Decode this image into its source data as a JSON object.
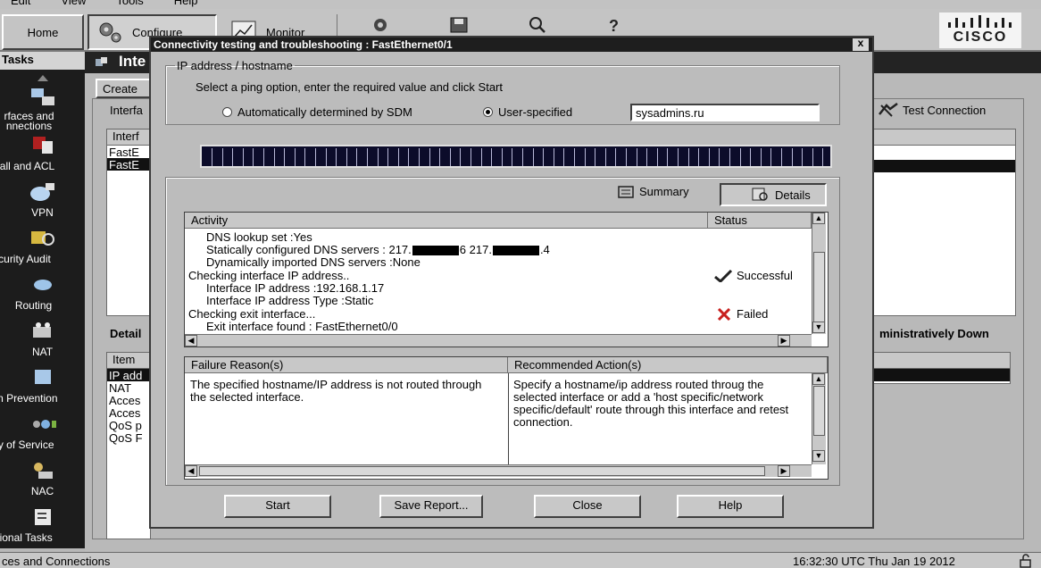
{
  "menubar": {
    "items": [
      "Edit",
      "View",
      "Tools",
      "Help"
    ]
  },
  "toolbar": {
    "home": "Home",
    "configure": "Configure",
    "monitor": "Monitor"
  },
  "logo": {
    "text": "CISCO"
  },
  "tasks": {
    "heading": "Tasks",
    "items": [
      "rfaces and\nnnections",
      "vall and ACL",
      "VPN",
      "curity Audit",
      "Routing",
      "NAT",
      "on Prevention",
      "ty of Service",
      "NAC",
      "tional Tasks"
    ]
  },
  "main": {
    "title": "Inte",
    "create_tab": "Create",
    "interface_label": "Interfa",
    "iface_header": "Interf",
    "iface_rows": [
      "FastE",
      "FastE"
    ],
    "test_connection": "Test Connection",
    "details_label": "Detail",
    "admin_down": "ministratively Down",
    "item_header": "Item",
    "item_rows": [
      "IP add",
      "NAT",
      "Acces",
      "Acces",
      "QoS p",
      "QoS F"
    ]
  },
  "status_bar": {
    "left": "ces and Connections",
    "time": "16:32:30 UTC Thu Jan 19 2012"
  },
  "dialog": {
    "title": "Connectivity testing and troubleshooting : FastEthernet0/1",
    "close_glyph": "x",
    "group_label": "IP address / hostname",
    "instruction": "Select a ping option, enter the required value and click Start",
    "radio_auto": "Automatically determined by SDM",
    "radio_user": "User-specified",
    "selected_option": "User-specified",
    "host_value": "sysadmins.ru",
    "summary_tab": "Summary",
    "details_tab": "Details",
    "activity_col": "Activity",
    "status_col": "Status",
    "activity": [
      {
        "text": "DNS lookup set :Yes",
        "indent": true,
        "status": ""
      },
      {
        "text_a": "Statically configured DNS servers : 217.",
        "text_b": "6 217.",
        "text_c": ".4",
        "indent": true,
        "status": ""
      },
      {
        "text": "Dynamically imported DNS servers :None",
        "indent": true,
        "status": ""
      },
      {
        "text": "Checking interface IP address..",
        "indent": false,
        "status": "Successful"
      },
      {
        "text": "Interface IP address :192.168.1.17",
        "indent": true,
        "status": ""
      },
      {
        "text": "Interface IP address Type :Static",
        "indent": true,
        "status": ""
      },
      {
        "text": "Checking exit interface...",
        "indent": false,
        "status": "Failed"
      },
      {
        "text": "Exit interface found : FastEthernet0/0",
        "indent": true,
        "status": ""
      }
    ],
    "failure_col": "Failure Reason(s)",
    "action_col": "Recommended Action(s)",
    "failure_text": "The specified hostname/IP address is not routed through the selected interface.",
    "action_text": "Specify a hostname/ip address routed throug the selected interface or add a 'host specific/network specific/default' route through this interface and retest connection.",
    "buttons": {
      "start": "Start",
      "save": "Save Report...",
      "close": "Close",
      "help": "Help"
    }
  }
}
